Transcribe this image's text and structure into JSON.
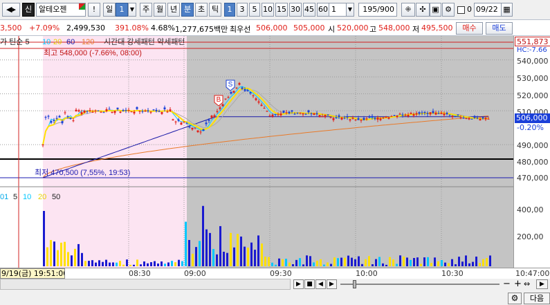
{
  "toolbar": {
    "back_icon": "arrow-left-icon",
    "market_label": "신",
    "stock_name": "알테오젠",
    "warn_label": "!",
    "period_day": "일",
    "period_day_count": "1",
    "period_week": "주",
    "period_month": "월",
    "period_year": "년",
    "period_min": "분",
    "period_sec": "초",
    "period_tick": "틱",
    "intervals": [
      "1",
      "3",
      "5",
      "10",
      "15",
      "30",
      "45",
      "60"
    ],
    "interval_input": "1",
    "count_display": "195/900",
    "checkbox_label": "0",
    "date_value": "09/22"
  },
  "quote": {
    "price_partial": "3,500",
    "change_pct": "+7.09%",
    "volume": "2,499,530",
    "volume_ratio": "391.08%",
    "turnover_pct": "4.68%",
    "amount": "1,277,675백만",
    "best_label": "최우선",
    "best_ask": "506,000",
    "best_bid": "505,000",
    "open_label": "시",
    "open": "520,000",
    "high_label": "고",
    "high": "548,000",
    "low_label": "저",
    "low": "495,500",
    "buy_label": "매수",
    "sell_label": "매도"
  },
  "chart": {
    "legend_price": "가 틴순 5",
    "legend_ma": [
      "10",
      "20",
      "60",
      "120"
    ],
    "legend_extra": "시간대 강세패턴  약세패턴",
    "high_annotation": "최고 548,000 (-7.66%, 08:00)",
    "low_annotation": "최저 470,500 (7,55%, 19:53)",
    "volume_legend": [
      "01",
      "5",
      "10",
      "20",
      "50"
    ],
    "current_price": "506,000",
    "current_change": "-0.20%",
    "top_price": "551,873",
    "top_note": "HC:-7.66",
    "y_labels": [
      "540,000",
      "530,000",
      "520,000",
      "510,000",
      "490,000",
      "480,000",
      "470,000"
    ],
    "vol_labels": [
      "400,00",
      "200,00"
    ],
    "marker_s": "S",
    "marker_b": "B",
    "colors": {
      "candle_up": "#e0201a",
      "candle_down": "#1a3fd9",
      "ma5": "#ffe000",
      "ma10": "#00d0ff",
      "ma60": "#1a1aa8",
      "ma120": "#e87a2a",
      "premarket_bg": "#fce4f2",
      "session_bg": "#c4c4c4"
    }
  },
  "time_axis": {
    "cursor_label": "9/19(금) 19:51:00",
    "labels": [
      "08:30",
      "09:00",
      "09:30",
      "10:00",
      "10:30",
      "10:47:00"
    ]
  },
  "bottom": {
    "next_label": "다음"
  }
}
